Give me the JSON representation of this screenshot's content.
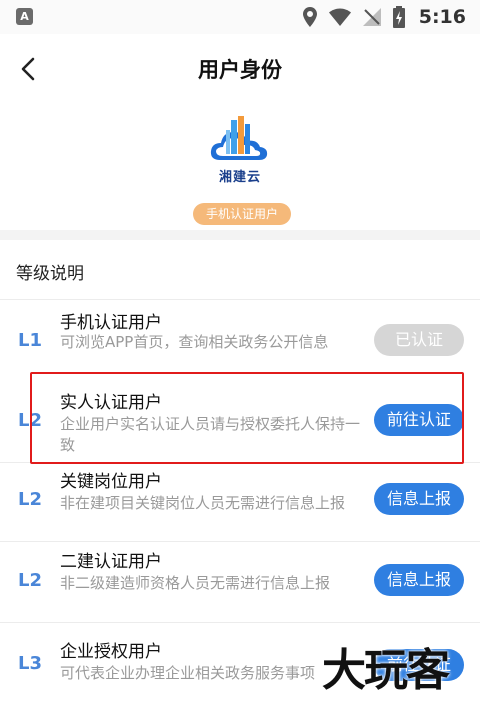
{
  "status_bar": {
    "time": "5:16",
    "left_badge": "A"
  },
  "nav": {
    "title": "用户身份"
  },
  "header": {
    "logo_text": "湘建云",
    "badge": "手机认证用户"
  },
  "section": {
    "title": "等级说明"
  },
  "levels": [
    {
      "level": "L1",
      "name": "手机认证用户",
      "desc": "可浏览APP首页，查询相关政务公开信息",
      "button": "已认证",
      "state": "done"
    },
    {
      "level": "L2",
      "name": "实人认证用户",
      "desc": "企业用户实名认证人员请与授权委托人保持一致",
      "button": "前往认证",
      "state": "action"
    },
    {
      "level": "L2",
      "name": "关键岗位用户",
      "desc": "非在建项目关键岗位人员无需进行信息上报",
      "button": "信息上报",
      "state": "action"
    },
    {
      "level": "L2",
      "name": "二建认证用户",
      "desc": "非二级建造师资格人员无需进行信息上报",
      "button": "信息上报",
      "state": "action"
    },
    {
      "level": "L3",
      "name": "企业授权用户",
      "desc": "可代表企业办理企业相关政务服务事项",
      "button": "前往认证",
      "state": "action"
    }
  ],
  "watermark": "大玩客",
  "colors": {
    "accent_blue": "#2f7fe1",
    "level_blue": "#4a86d8",
    "badge_orange": "#f5b97a",
    "highlight_red": "#e11b1b"
  }
}
